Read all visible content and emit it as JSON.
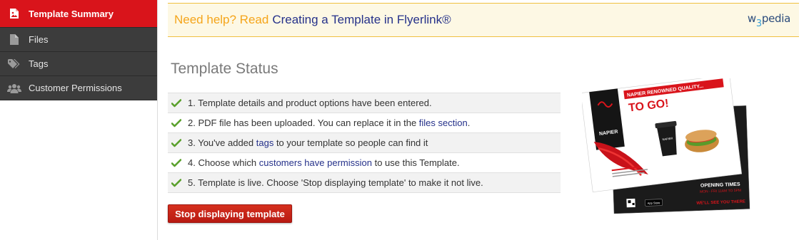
{
  "sidebar": {
    "items": [
      {
        "label": "Template Summary",
        "icon": "image-icon",
        "active": true
      },
      {
        "label": "Files",
        "icon": "file-icon",
        "active": false
      },
      {
        "label": "Tags",
        "icon": "tags-icon",
        "active": false
      },
      {
        "label": "Customer Permissions",
        "icon": "users-icon",
        "active": false
      }
    ]
  },
  "help": {
    "prefix": "Need help? Read",
    "link": "Creating a Template in Flyerlink®",
    "brand_before": "w",
    "brand_three": "3",
    "brand_after": "pedia"
  },
  "status": {
    "title": "Template Status",
    "items": [
      {
        "text": "1. Template details and product options have been entered."
      },
      {
        "before": "2. PDF file has been uploaded. You can replace it in the ",
        "link": "files section",
        "after": "."
      },
      {
        "before": "3. You've added ",
        "link": "tags",
        "after": " to your template so people can find it"
      },
      {
        "before": "4. Choose which ",
        "link": "customers have permission",
        "after": " to use this Template."
      },
      {
        "text": "5. Template is live. Choose 'Stop displaying template' to make it not live."
      }
    ]
  },
  "button": {
    "label": "Stop displaying template"
  },
  "preview": {
    "headline": "NAPIER RENOWNED QUALITY...",
    "tagline": "TO GO!",
    "brand": "NAPIER",
    "cup_brand": "NAPIER",
    "opening_title": "OPENING TIMES",
    "opening_hours": "MON - FRI 11AM TO 5PM",
    "footer": "WE'LL SEE YOU THERE",
    "store_badge": "App Store"
  },
  "colors": {
    "sidebar_active": "#d9141b",
    "sidebar_bg": "#3c3c3c",
    "help_orange": "#f5a51a",
    "link_blue": "#25318a",
    "check_green": "#5aa02c",
    "button_red": "#c8221a"
  }
}
